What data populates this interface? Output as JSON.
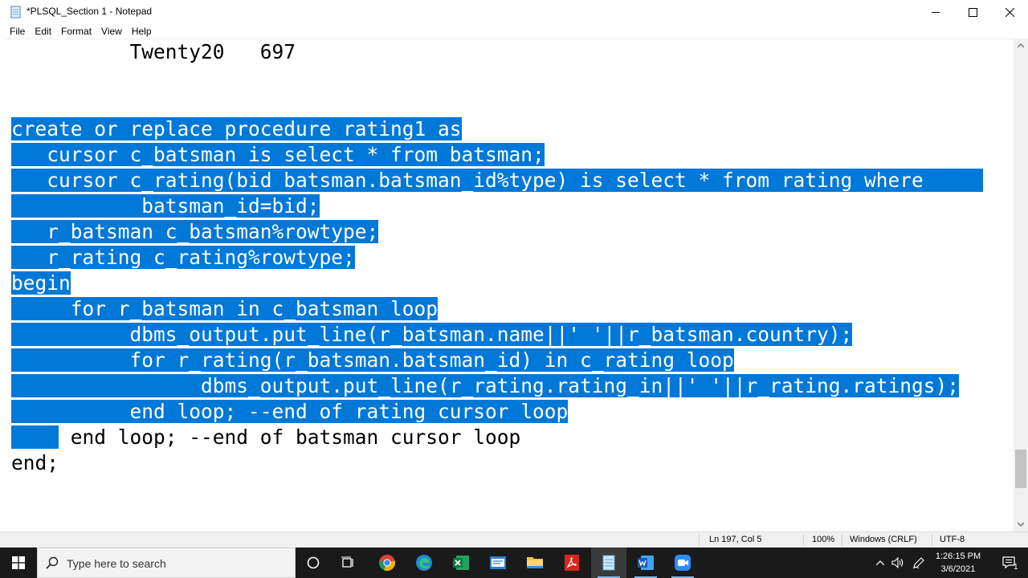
{
  "window": {
    "title": "*PLSQL_Section 1 - Notepad"
  },
  "menu": {
    "items": [
      "File",
      "Edit",
      "Format",
      "View",
      "Help"
    ]
  },
  "editor": {
    "lines": [
      {
        "text": "          Twenty20   697",
        "selected": false
      },
      {
        "text": "",
        "selected": false
      },
      {
        "text": "",
        "selected": false
      },
      {
        "text": "create or replace procedure rating1 as",
        "selected": true
      },
      {
        "text": "   cursor c_batsman is select * from batsman;",
        "selected": true
      },
      {
        "text": "   cursor c_rating(bid batsman.batsman_id%type) is select * from rating where     ",
        "selected": true
      },
      {
        "text": "           batsman_id=bid;",
        "selected": true
      },
      {
        "text": "   r_batsman c_batsman%rowtype;",
        "selected": true
      },
      {
        "text": "   r_rating c_rating%rowtype;",
        "selected": true
      },
      {
        "text": "begin",
        "selected": true
      },
      {
        "text": "     for r_batsman in c_batsman loop",
        "selected": true
      },
      {
        "text": "          dbms_output.put_line(r_batsman.name||' '||r_batsman.country);",
        "selected": true
      },
      {
        "text": "          for r_rating(r_batsman.batsman_id) in c_rating loop",
        "selected": true
      },
      {
        "text": "                dbms_output.put_line(r_rating.rating_in||' '||r_rating.ratings);",
        "selected": true
      },
      {
        "text": "          end loop; --end of rating cursor loop",
        "selected": true
      },
      {
        "text": "     end loop; --end of batsman cursor loop",
        "selected": false,
        "partial_selected_prefix": "    "
      },
      {
        "text": "end;",
        "selected": false
      }
    ]
  },
  "statusbar": {
    "position": "Ln 197, Col 5",
    "zoom": "100%",
    "line_ending": "Windows (CRLF)",
    "encoding": "UTF-8"
  },
  "taskbar": {
    "search_placeholder": "Type here to search",
    "time": "1:26:15 PM",
    "date": "3/6/2021",
    "notification_count": "1"
  },
  "colors": {
    "selection": "#0078d7",
    "taskbar": "#1a1a1a"
  }
}
